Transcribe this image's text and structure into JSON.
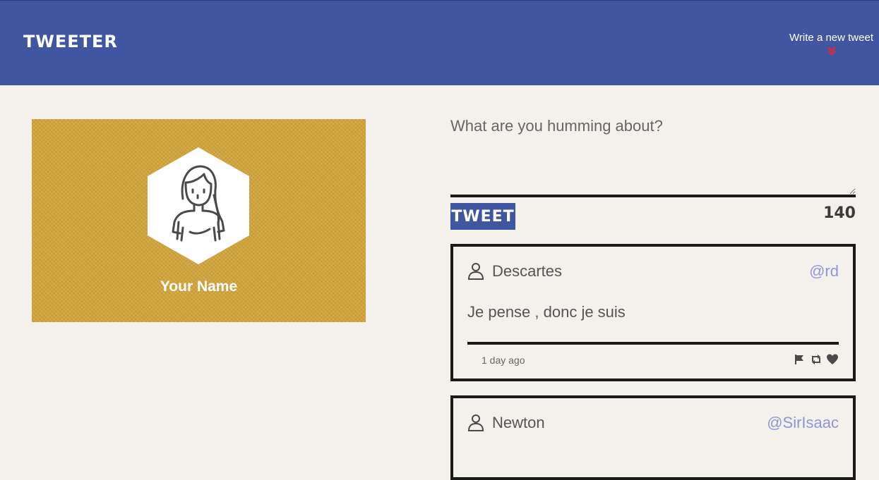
{
  "nav": {
    "brand": "TWEETER",
    "compose_label": "Write a new tweet",
    "compose_icon": "double-chevron-down-icon",
    "accent_color": "#e8243c",
    "background_color": "#4056a1"
  },
  "profile": {
    "name": "Your Name",
    "avatar_icon": "person-avatar-icon",
    "card_color": "#d3a43a"
  },
  "composer": {
    "placeholder": "What are you humming about?",
    "value": "",
    "submit_label": "TWEET",
    "counter": "140"
  },
  "tweets": [
    {
      "name": "Descartes",
      "handle": "@rd",
      "content": "Je pense , donc je suis",
      "time": "1 day ago",
      "actions": [
        "flag-icon",
        "retweet-icon",
        "heart-icon"
      ]
    },
    {
      "name": "Newton",
      "handle": "@SirIsaac"
    }
  ]
}
